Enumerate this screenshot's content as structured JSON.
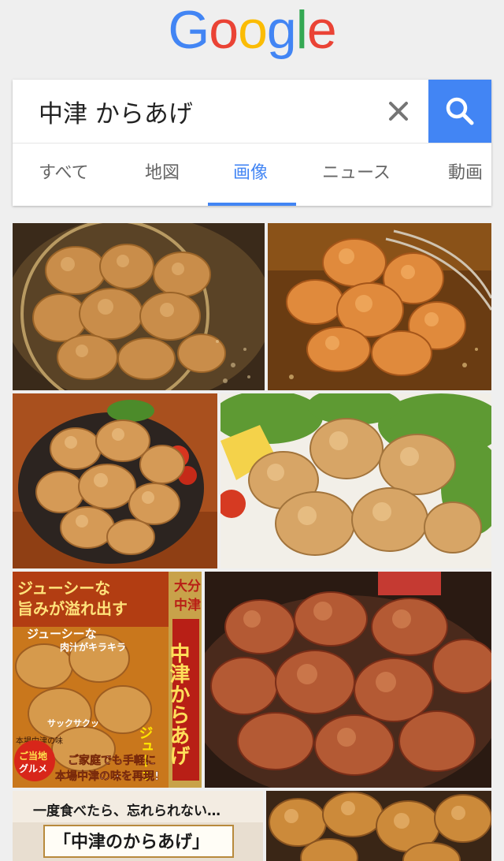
{
  "logo": {
    "letters": [
      "G",
      "o",
      "o",
      "g",
      "l",
      "e"
    ],
    "colors": [
      "#4285f4",
      "#ea4335",
      "#fbbc05",
      "#4285f4",
      "#34a853",
      "#ea4335"
    ]
  },
  "search": {
    "query": "中津 からあげ"
  },
  "tabs": [
    {
      "label": "すべて",
      "active": false
    },
    {
      "label": "地図",
      "active": false
    },
    {
      "label": "画像",
      "active": true
    },
    {
      "label": "ニュース",
      "active": false
    },
    {
      "label": "動画",
      "active": false
    }
  ],
  "accent_color": "#4285f4",
  "results": {
    "image5_text": {
      "line1": "ジューシーな",
      "line2": "旨みが溢れ出す",
      "line3": "ジューシーな",
      "line4": "肉汁がキラキラ",
      "vertical1": "大分",
      "vertical2": "中津",
      "vertical3": "中津からあげ",
      "sizzle": "ジューッ",
      "crisp": "サックサクッ",
      "local": "本場中津の味",
      "badge1": "ご当地",
      "badge2": "グルメ",
      "bottom1": "ご家庭でも手軽に",
      "bottom2": "本場中津の味を再現!"
    },
    "image7_text": {
      "line1": "一度食べたら、忘れられない…",
      "line2": "「中津のからあげ」"
    }
  }
}
